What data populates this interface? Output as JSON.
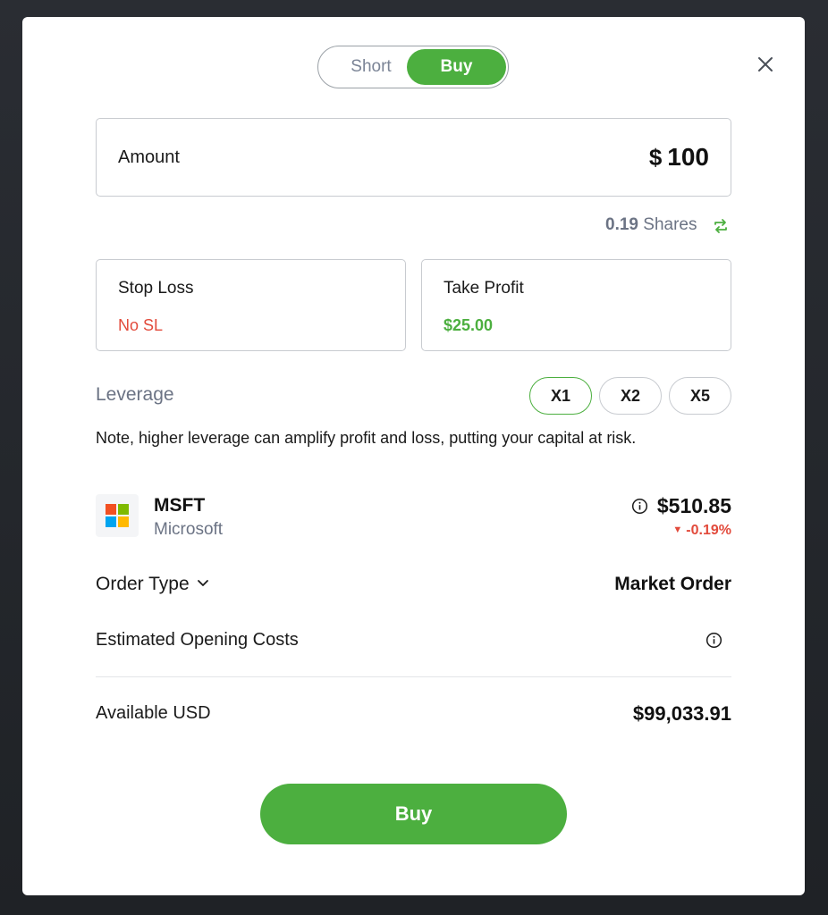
{
  "toggle": {
    "short_label": "Short",
    "buy_label": "Buy",
    "selected": "Buy"
  },
  "amount": {
    "label": "Amount",
    "currency": "$",
    "value": "100"
  },
  "shares": {
    "value": "0.19",
    "unit": "Shares"
  },
  "stop_loss": {
    "title": "Stop Loss",
    "value": "No SL"
  },
  "take_profit": {
    "title": "Take Profit",
    "value": "$25.00"
  },
  "leverage": {
    "label": "Leverage",
    "options": [
      "X1",
      "X2",
      "X5"
    ],
    "selected": "X1",
    "note": "Note, higher leverage can amplify profit and loss, putting your capital at risk."
  },
  "instrument": {
    "ticker": "MSFT",
    "company": "Microsoft",
    "price": "$510.85",
    "change": "-0.19%"
  },
  "order_type": {
    "label": "Order Type",
    "value": "Market Order"
  },
  "estimated_costs": {
    "label": "Estimated Opening Costs"
  },
  "available": {
    "label": "Available USD",
    "value": "$99,033.91"
  },
  "submit": {
    "label": "Buy"
  },
  "colors": {
    "accent_green": "#4caf3f",
    "negative_red": "#e24a3b",
    "muted_text": "#6b7384"
  },
  "icons": [
    "close-icon",
    "swap-icon",
    "info-icon",
    "chevron-down-icon",
    "microsoft-logo"
  ]
}
